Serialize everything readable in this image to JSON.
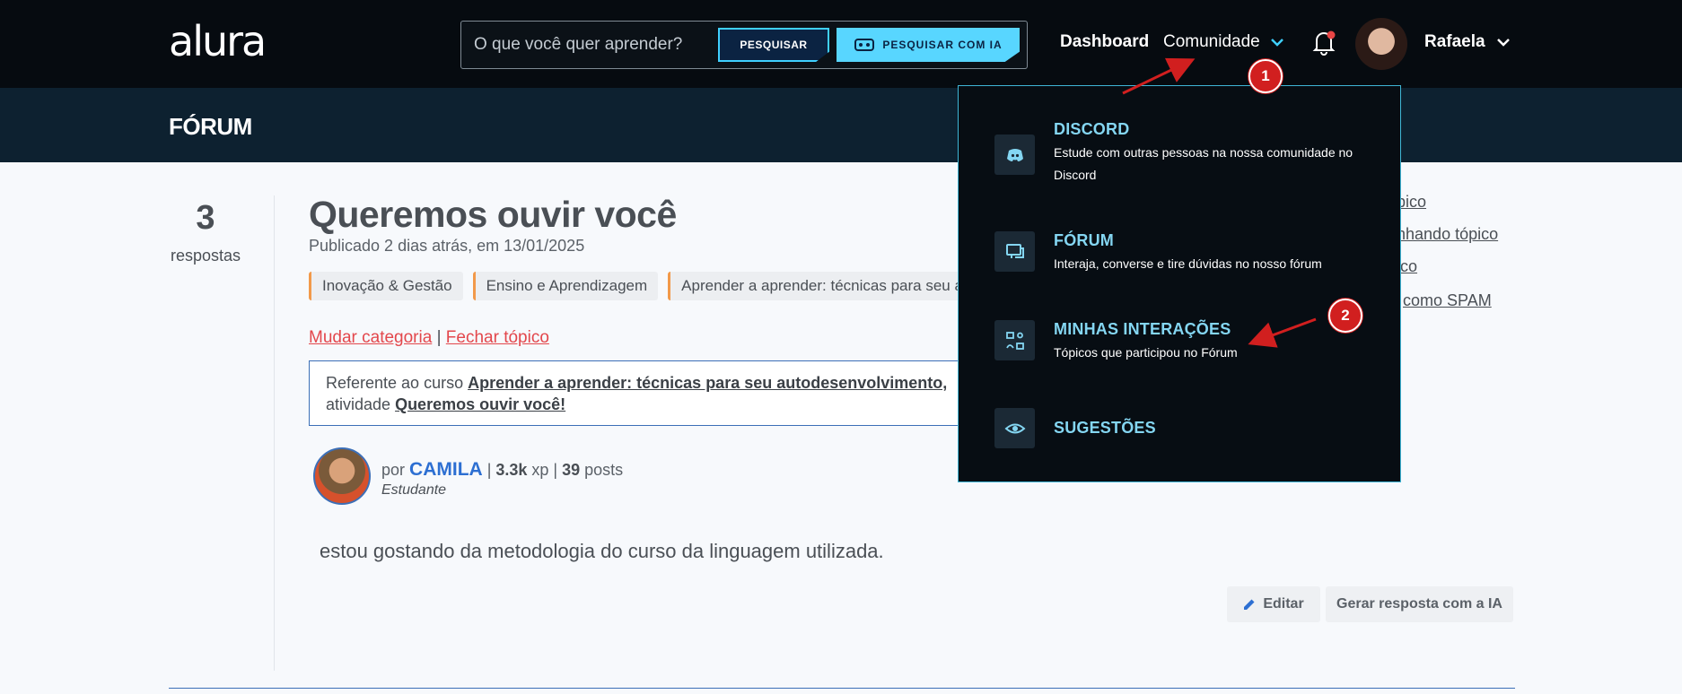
{
  "topbar": {
    "logo": "alura",
    "search_placeholder": "O que você quer aprender?",
    "search_button": "PESQUISAR",
    "ia_button": "PESQUISAR COM IA",
    "nav_dashboard": "Dashboard",
    "nav_comunidade": "Comunidade",
    "user_name": "Rafaela"
  },
  "forum": {
    "title": "FÓRUM"
  },
  "topic": {
    "replies_count": "3",
    "replies_label": "respostas",
    "title": "Queremos ouvir você",
    "published": "Publicado 2 dias atrás, em 13/01/2025",
    "tags": [
      "Inovação & Gestão",
      "Ensino e Aprendizagem",
      "Aprender a aprender: técnicas para seu au"
    ],
    "change_category": "Mudar categoria",
    "separator": "|",
    "close_topic": "Fechar tópico",
    "course_prefix": "Referente ao curso ",
    "course_name": "Aprender a aprender: técnicas para seu autodesenvolvimento,",
    "activity_prefix": "atividade ",
    "activity_name": "Queremos ouvir você!",
    "author_prefix": "por ",
    "author_name": "CAMILA",
    "author_sep1": " | ",
    "author_xp": "3.3k",
    "author_xp_unit": " xp | ",
    "author_posts": "39",
    "author_posts_unit": " posts",
    "author_role": "Estudante",
    "post_text": "estou gostando da metodologia do curso da linguagem utilizada.",
    "edit_button": "Editar",
    "ai_reply_button": "Gerar resposta com a IA"
  },
  "side_actions": [
    "ópico",
    "anhando tópico",
    "pico",
    "como SPAM"
  ],
  "dropdown": {
    "items": [
      {
        "title": "DISCORD",
        "desc": "Estude com outras pessoas na nossa comunidade no Discord",
        "icon": "discord-icon"
      },
      {
        "title": "FÓRUM",
        "desc": "Interaja, converse e tire dúvidas no nosso fórum",
        "icon": "forum-chat-icon"
      },
      {
        "title": "MINHAS INTERAÇÕES",
        "desc": "Tópicos que participou no Fórum",
        "icon": "interactions-icon"
      },
      {
        "title": "SUGESTÕES",
        "desc": "",
        "icon": "eye-icon"
      }
    ]
  },
  "annotations": {
    "marker_1": "1",
    "marker_2": "2",
    "color": "#d11f1f"
  }
}
